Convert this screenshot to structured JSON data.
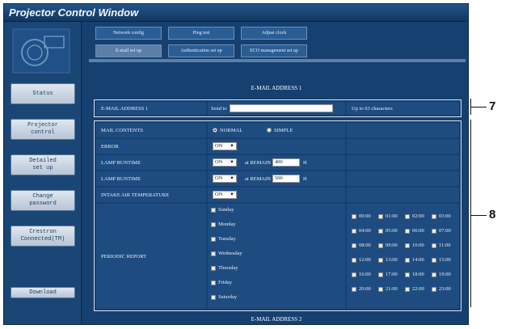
{
  "window": {
    "title": "Projector Control Window"
  },
  "sidebar": {
    "logo_icon": "projector-logo-icon",
    "items": [
      {
        "label": "Status"
      },
      {
        "label": "Projector\ncontrol"
      },
      {
        "label": "Detailed\nset up"
      },
      {
        "label": "Change\npassword"
      },
      {
        "label": "Crestron\nConnected(TM)"
      },
      {
        "label": "Download"
      }
    ]
  },
  "tabs": {
    "row1": [
      {
        "label": "Network config"
      },
      {
        "label": "Ping test"
      },
      {
        "label": "Adjust clock"
      }
    ],
    "row2": [
      {
        "label": "E-mail set up"
      },
      {
        "label": "Authentication set up"
      },
      {
        "label": "ECO management set up"
      }
    ]
  },
  "section1": {
    "title": "E-MAIL ADDRESS 1",
    "address_label": "E-MAIL ADDRESS 1",
    "send_to": "Send to",
    "send_to_value": "",
    "hint": "Up to 63 characters"
  },
  "settings": {
    "mail_contents": {
      "label": "MAIL CONTENTS",
      "option1": "NORMAL",
      "option2": "SIMPLE",
      "selected": "NORMAL"
    },
    "error": {
      "label": "ERROR",
      "value": "ON"
    },
    "lamp1": {
      "label": "LAMP RUNTIME",
      "value": "ON",
      "at_remain": "at REMAIN",
      "hours": "400",
      "unit": "H"
    },
    "lamp2": {
      "label": "LAMP RUNTIME",
      "value": "ON",
      "at_remain": "at REMAIN",
      "hours": "500",
      "unit": "H"
    },
    "intake": {
      "label": "INTAKE AIR TEMPERATURE",
      "value": "ON"
    },
    "periodic": {
      "label": "PERIODIC REPORT",
      "days": [
        "Sunday",
        "Monday",
        "Tuesday",
        "Wednesday",
        "Thursday",
        "Friday",
        "Saturday"
      ],
      "hours": [
        "00:00",
        "01:00",
        "02:00",
        "03:00",
        "04:00",
        "05:00",
        "06:00",
        "07:00",
        "08:00",
        "09:00",
        "10:00",
        "11:00",
        "12:00",
        "13:00",
        "14:00",
        "15:00",
        "16:00",
        "17:00",
        "18:00",
        "19:00",
        "20:00",
        "21:00",
        "22:00",
        "23:00"
      ]
    }
  },
  "section2": {
    "title": "E-MAIL ADDRESS 2"
  },
  "callouts": {
    "a": "7",
    "b": "8"
  },
  "colors": {
    "window_bg": "#143a63",
    "panel_bg": "#1e4c80",
    "frame": "#d8e2ee"
  }
}
